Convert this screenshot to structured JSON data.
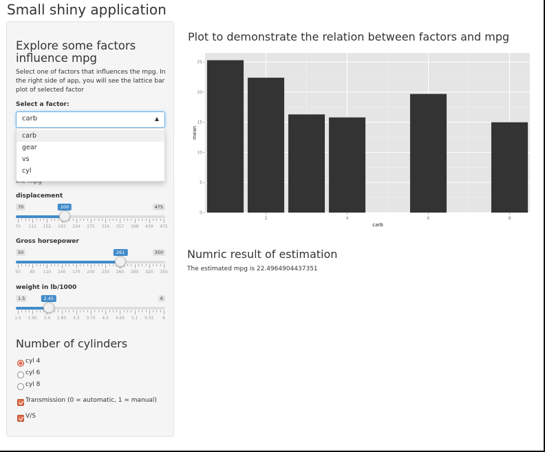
{
  "app": {
    "title": "Small shiny application"
  },
  "sidebar": {
    "heading": "Explore some factors influence mpg",
    "description": "Select one of factors that influences the mpg. In the right side of app, you will see the lattice bar plot of selected factor",
    "select_label": "Select a factor:",
    "select_value": "carb",
    "select_options": [
      "carb",
      "gear",
      "vs",
      "cyl"
    ],
    "hidden_text": "the mpg"
  },
  "sliders": [
    {
      "label": "displacement",
      "min": "70",
      "max": "475",
      "value": "200",
      "min_num": 70,
      "max_num": 475,
      "value_num": 200,
      "ticks": [
        "70",
        "111",
        "152",
        "193",
        "234",
        "275",
        "316",
        "357",
        "398",
        "439",
        "475"
      ]
    },
    {
      "label": "Gross horsepower",
      "min": "50",
      "max": "350",
      "value": "261",
      "min_num": 50,
      "max_num": 350,
      "value_num": 261,
      "ticks": [
        "50",
        "80",
        "110",
        "140",
        "170",
        "200",
        "230",
        "260",
        "290",
        "320",
        "350"
      ]
    },
    {
      "label": "weight in lb/1000",
      "min": "1.5",
      "max": "6",
      "value": "2.45",
      "min_num": 1.5,
      "max_num": 6,
      "value_num": 2.45,
      "ticks": [
        "1.5",
        "1.95",
        "2.4",
        "2.85",
        "3.3",
        "3.75",
        "4.2",
        "4.65",
        "5.1",
        "5.55",
        "6"
      ]
    }
  ],
  "cylinders": {
    "heading": "Number of cylinders",
    "options": [
      "cyl 4",
      "cyl 6",
      "cyl 8"
    ],
    "selected": "cyl 4"
  },
  "checkboxes": [
    {
      "label": "Transmission (0 = automatic, 1 = manual)",
      "checked": true
    },
    {
      "label": "V/S",
      "checked": true
    }
  ],
  "plot_title": "Plot to demonstrate the relation between factors and mpg",
  "colors": {
    "bar": "#333333",
    "panel": "#e5e5e5",
    "grid": "#ffffff",
    "accent": "#428bca"
  },
  "chart_data": {
    "type": "bar",
    "x": [
      1,
      2,
      3,
      4,
      6,
      8
    ],
    "values": [
      25.3,
      22.4,
      16.3,
      15.8,
      19.7,
      15.0
    ],
    "xlabel": "carb",
    "ylabel": "mean",
    "xlim": [
      0.5,
      8.5
    ],
    "ylim": [
      0,
      26.5
    ],
    "xticks": [
      2,
      4,
      6,
      8
    ],
    "yticks": [
      0,
      5,
      10,
      15,
      20,
      25
    ],
    "grid": true,
    "legend": "none"
  },
  "result": {
    "heading": "Numric result of estimation",
    "prefix": "The estimated mpg is ",
    "value": "22.4964904437351"
  }
}
